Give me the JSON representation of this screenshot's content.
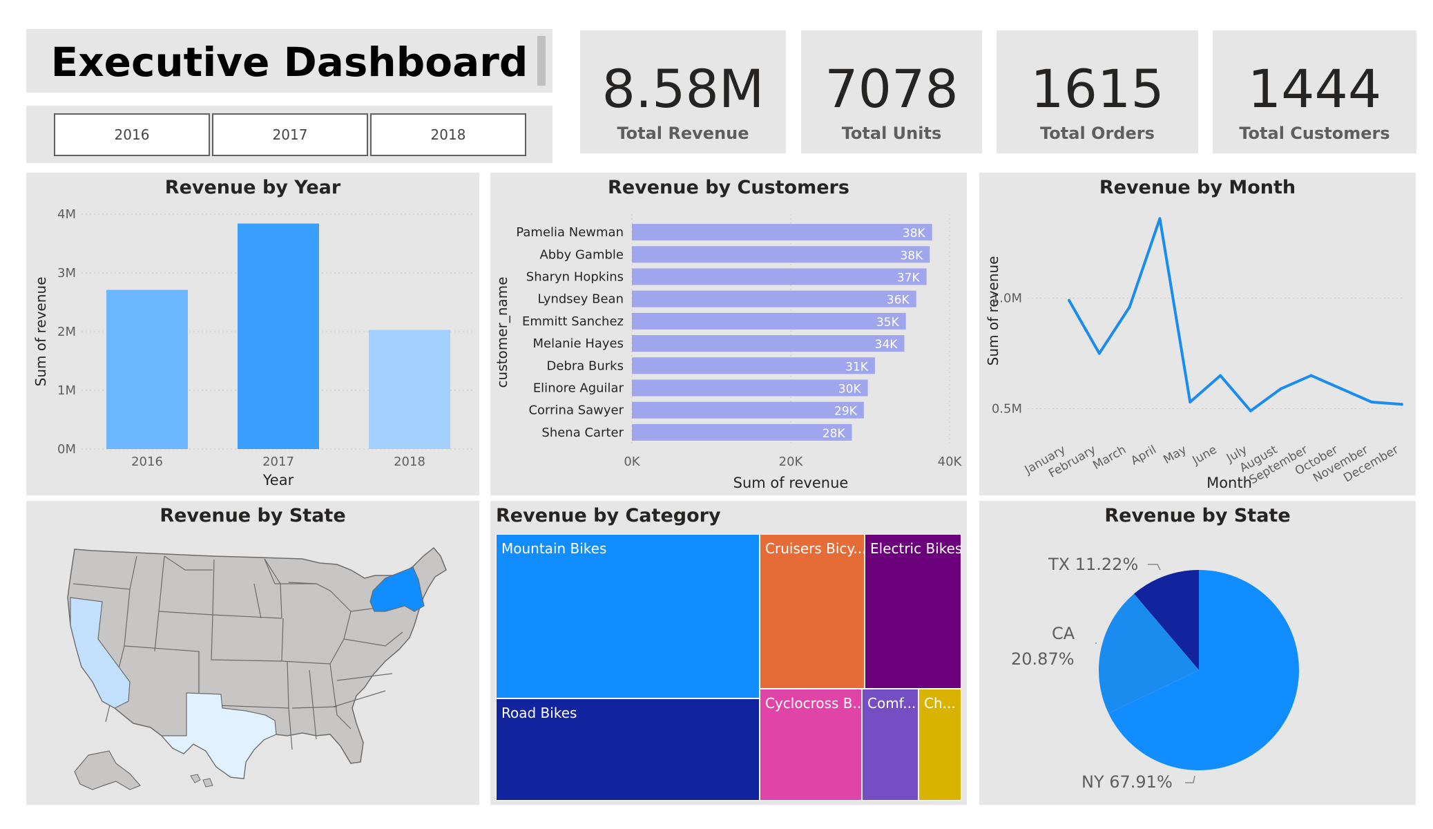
{
  "header": {
    "title": "Executive Dashboard"
  },
  "slicer": {
    "years": [
      "2016",
      "2017",
      "2018"
    ]
  },
  "kpis": [
    {
      "value": "8.58M",
      "label": "Total Revenue"
    },
    {
      "value": "7078",
      "label": "Total Units"
    },
    {
      "value": "1615",
      "label": "Total Orders"
    },
    {
      "value": "1444",
      "label": "Total Customers"
    }
  ],
  "colors": {
    "panel_bg": "#e6e6e6",
    "bar_2016": "#6cb6ff",
    "bar_2017": "#3a9efd",
    "bar_2018": "#a3d0ff",
    "customer_bar": "#a0a6ee",
    "line": "#1a8cf0",
    "state_default": "#c8c6c4",
    "state_ny": "#118dff",
    "state_ca": "#c3e1ff",
    "state_tx": "#e2f1ff",
    "pie_ny": "#118dff",
    "pie_ca": "#1a8cf0",
    "pie_tx": "#12239e"
  },
  "chart_data": [
    {
      "id": "revenue-by-year",
      "type": "bar",
      "title": "Revenue by Year",
      "xlabel": "Year",
      "ylabel": "Sum of revenue",
      "categories": [
        "2016",
        "2017",
        "2018"
      ],
      "values": [
        2.71,
        3.84,
        2.03
      ],
      "value_unit": "M",
      "ylim": [
        0,
        4
      ],
      "yticks": [
        "0M",
        "1M",
        "2M",
        "3M",
        "4M"
      ],
      "grid": true
    },
    {
      "id": "revenue-by-customers",
      "type": "bar",
      "orientation": "horizontal",
      "title": "Revenue by Customers",
      "xlabel": "Sum of revenue",
      "ylabel": "customer_name",
      "categories": [
        "Pamelia Newman",
        "Abby Gamble",
        "Sharyn Hopkins",
        "Lyndsey Bean",
        "Emmitt Sanchez",
        "Melanie Hayes",
        "Debra Burks",
        "Elinore Aguilar",
        "Corrina Sawyer",
        "Shena Carter"
      ],
      "values": [
        37.8,
        37.5,
        37.1,
        35.8,
        34.5,
        34.3,
        30.6,
        29.7,
        29.2,
        27.7
      ],
      "data_labels": [
        "38K",
        "38K",
        "37K",
        "36K",
        "35K",
        "34K",
        "31K",
        "30K",
        "29K",
        "28K"
      ],
      "xlim": [
        0,
        40
      ],
      "xticks": [
        "0K",
        "20K",
        "40K"
      ],
      "grid": true
    },
    {
      "id": "revenue-by-month",
      "type": "line",
      "title": "Revenue by Month",
      "xlabel": "Month",
      "ylabel": "Sum of revenue",
      "categories": [
        "January",
        "February",
        "March",
        "April",
        "May",
        "June",
        "July",
        "August",
        "September",
        "October",
        "November",
        "December"
      ],
      "values": [
        0.99,
        0.75,
        0.96,
        1.36,
        0.53,
        0.65,
        0.49,
        0.59,
        0.65,
        0.59,
        0.53,
        0.52
      ],
      "value_unit": "M",
      "ylim": [
        0.38,
        1.38
      ],
      "yticks": [
        {
          "value": 0.5,
          "label": "0.5M"
        },
        {
          "value": 1.0,
          "label": "1.0M"
        }
      ],
      "grid": true
    },
    {
      "id": "revenue-by-category",
      "type": "treemap",
      "title": "Revenue by Category",
      "items": [
        {
          "label": "Mountain Bikes",
          "color": "#118dff"
        },
        {
          "label": "Road Bikes",
          "color": "#12239e"
        },
        {
          "label": "Cruisers Bicy...",
          "color": "#e66c37"
        },
        {
          "label": "Electric Bikes",
          "color": "#6b007b"
        },
        {
          "label": "Cyclocross B...",
          "color": "#e044a7"
        },
        {
          "label": "Comf...",
          "color": "#744ec2"
        },
        {
          "label": "Ch...",
          "color": "#d9b300"
        }
      ]
    },
    {
      "id": "revenue-by-state-pie",
      "type": "pie",
      "title": "Revenue by State",
      "slices": [
        {
          "label": "NY",
          "value": 67.91,
          "text": "NY 67.91%",
          "color": "#118dff"
        },
        {
          "label": "CA",
          "value": 20.87,
          "text_line1": "CA",
          "text_line2": "20.87%",
          "color": "#1a8cf0"
        },
        {
          "label": "TX",
          "value": 11.22,
          "text": "TX 11.22%",
          "color": "#12239e"
        }
      ]
    }
  ],
  "map": {
    "title": "Revenue by State",
    "highlighted": [
      "NY",
      "CA",
      "TX"
    ]
  }
}
